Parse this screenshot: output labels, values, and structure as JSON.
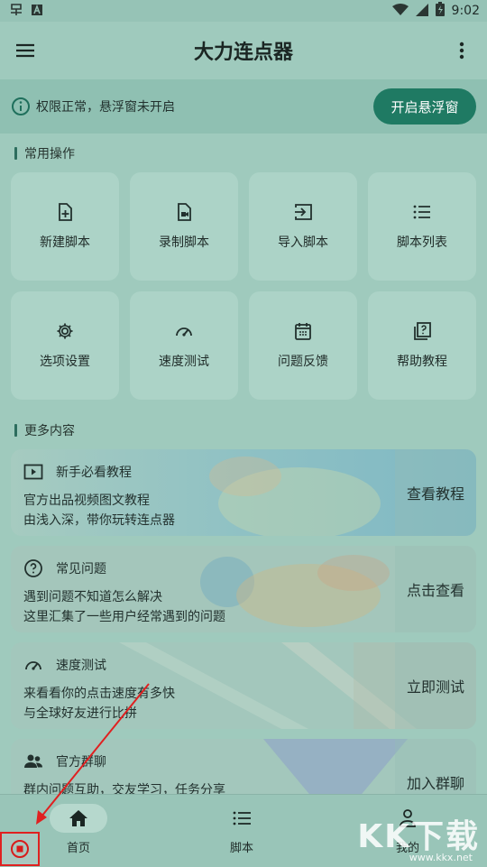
{
  "status": {
    "time": "9:02"
  },
  "appbar": {
    "title": "大力连点器"
  },
  "notice": {
    "text": "权限正常，悬浮窗未开启",
    "button": "开启悬浮窗"
  },
  "sections": {
    "common": "常用操作",
    "more": "更多内容"
  },
  "tiles": [
    {
      "label": "新建脚本",
      "icon": "new-file-icon"
    },
    {
      "label": "录制脚本",
      "icon": "record-file-icon"
    },
    {
      "label": "导入脚本",
      "icon": "import-icon"
    },
    {
      "label": "脚本列表",
      "icon": "list-icon"
    },
    {
      "label": "选项设置",
      "icon": "gear-icon"
    },
    {
      "label": "速度测试",
      "icon": "speedometer-icon"
    },
    {
      "label": "问题反馈",
      "icon": "calendar-icon"
    },
    {
      "label": "帮助教程",
      "icon": "help-book-icon"
    }
  ],
  "cards": [
    {
      "title": "新手必看教程",
      "line1": "官方出品视频图文教程",
      "line2": "由浅入深，带你玩转连点器",
      "action": "查看教程",
      "icon": "play-video-icon"
    },
    {
      "title": "常见问题",
      "line1": "遇到问题不知道怎么解决",
      "line2": "这里汇集了一些用户经常遇到的问题",
      "action": "点击查看",
      "icon": "question-circle-icon"
    },
    {
      "title": "速度测试",
      "line1": "来看看你的点击速度有多快",
      "line2": "与全球好友进行比拼",
      "action": "立即测试",
      "icon": "speedometer-icon"
    },
    {
      "title": "官方群聊",
      "line1": "群内问题互助，交友学习，任务分享",
      "line2": "",
      "action": "加入群聊",
      "icon": "group-icon"
    }
  ],
  "nav": [
    {
      "label": "首页",
      "icon": "home-icon"
    },
    {
      "label": "脚本",
      "icon": "list-icon"
    },
    {
      "label": "我的",
      "icon": "person-icon"
    }
  ],
  "watermark": {
    "main": "KK下载",
    "url": "www.kkx.net"
  },
  "colors": {
    "accent": "#1f7a63",
    "background": "#9fcabd",
    "highlight": "#e02020"
  }
}
